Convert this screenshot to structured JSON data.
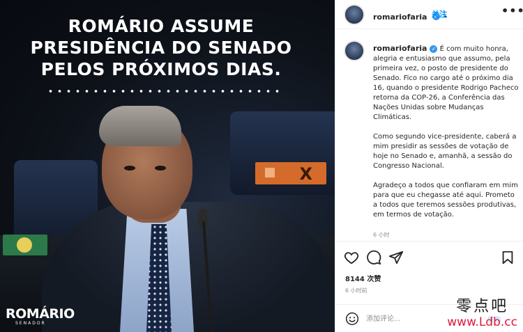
{
  "post_image": {
    "headline_lines": [
      "ROMÁRIO ASSUME",
      "PRESIDÊNCIA DO SENADO",
      "PELOS PRÓXIMOS DIAS."
    ],
    "logo_name": "ROMÁRIO",
    "logo_subtitle": "SENADOR"
  },
  "header": {
    "username": "romariofaria",
    "verified_mark": "✓",
    "follow_label": "关注",
    "more_label": "•••"
  },
  "caption": {
    "username": "romariofaria",
    "paragraphs": [
      "É com muito honra, alegria e entusiasmo que assumo, pela primeira vez, o posto de presidente do Senado. Fico no cargo até o próximo dia 16, quando o presidente Rodrigo Pacheco retorna da COP-26, a Conferência das Nações Unidas sobre Mudanças Climáticas.",
      "Como segundo vice-presidente, caberá a mim presidir as sessões de votação de hoje no Senado e, amanhã, a sessão do Congresso Nacional.",
      "Agradeço a todos que confiaram em mim para que eu chegasse até aqui. Prometo a todos que teremos sessões produtivas, em termos de votação."
    ],
    "time_ago": "6 小时"
  },
  "actions": {
    "icons": [
      "heart-icon",
      "comment-icon",
      "share-icon",
      "bookmark-icon"
    ]
  },
  "stats": {
    "likes": "8144 次赞",
    "timestamp": "6 小时前"
  },
  "comment": {
    "placeholder": "添加评论...",
    "post_label": "发布"
  },
  "watermark": {
    "chinese": "零点吧",
    "url": "www.Ldb.cc"
  },
  "colors": {
    "link_blue": "#0095f6",
    "verified_blue": "#3897f0",
    "post_disabled": "#b2dffc",
    "watermark_red": "#e0183c"
  }
}
